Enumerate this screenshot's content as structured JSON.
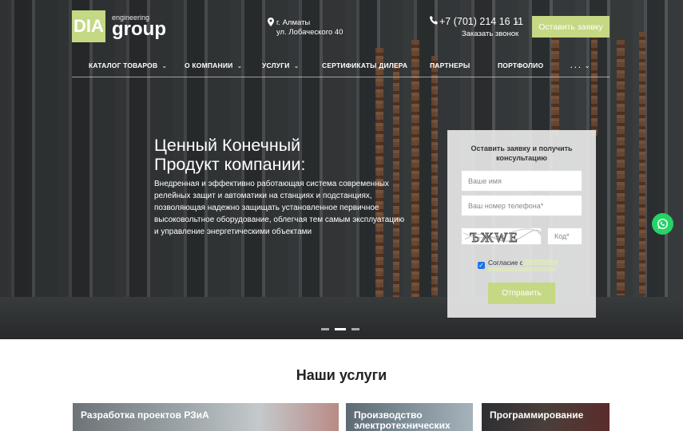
{
  "brand": {
    "logo": "DIA",
    "tagline": "engineering",
    "name": "group"
  },
  "address": {
    "line1": "г. Алматы",
    "line2": "ул. Лобаческого 40"
  },
  "contact": {
    "phone": "+7 (701) 214 16 11",
    "callback": "Заказать звонок"
  },
  "header_button": "Оставить заявку",
  "nav": [
    {
      "label": "КАТАЛОГ ТОВАРОВ",
      "chevron": true
    },
    {
      "label": "О КОМПАНИИ",
      "chevron": true
    },
    {
      "label": "УСЛУГИ",
      "chevron": true
    },
    {
      "label": "СЕРТИФИКАТЫ ДИЛЕРА",
      "chevron": false
    },
    {
      "label": "ПАРТНЕРЫ",
      "chevron": false
    },
    {
      "label": "ПОРТФОЛИО",
      "chevron": false
    },
    {
      "label": ". . .",
      "chevron": true
    }
  ],
  "hero": {
    "title_line1": "Ценный Конечный",
    "title_line2": "Продукт компании:",
    "text": "Внедренная и эффективно работающая система современных релейных защит и автоматики на станциях и подстанциях, позволяющая надежно защищать установленное первичное высоковольтное оборудование, облегчая тем самым эксплуатацию и управление энергетическими объектами"
  },
  "form": {
    "title": "Оставить заявку и получить консультацию",
    "name_placeholder": "Ваше имя",
    "phone_placeholder": "Ваш номер телефона*",
    "captcha_text": "ЪЖWE",
    "code_placeholder": "Код*",
    "agree": "Согласие с",
    "submit": "Отправить"
  },
  "services": {
    "title": "Наши услуги",
    "cards": [
      "Разработка проектов РЗиА",
      "Производство электротехнических",
      "Программирование"
    ]
  },
  "colors": {
    "accent": "#c5d884",
    "whatsapp": "#26d366"
  }
}
